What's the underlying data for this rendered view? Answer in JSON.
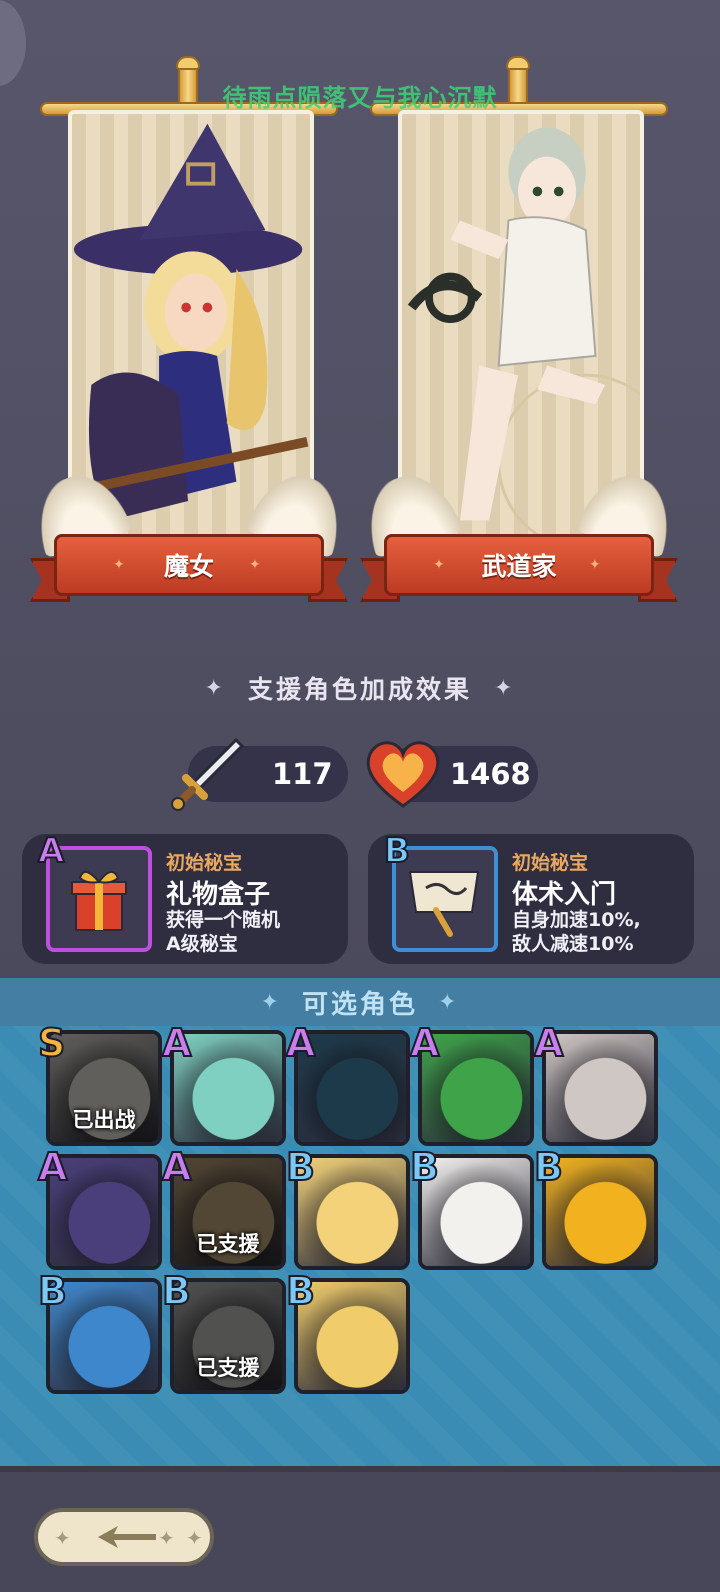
{
  "overlay_text": "待雨点陨落又与我心沉默",
  "banners": [
    {
      "name": "魔女",
      "palette": {
        "bg": "#2c2a52",
        "accent": "#f0c84b",
        "robe": "#3b3a8a"
      }
    },
    {
      "name": "武道家",
      "palette": {
        "bg": "#f4f1ea",
        "accent": "#9aa99a",
        "robe": "#ffffff"
      }
    }
  ],
  "support": {
    "title": "支援角色加成效果",
    "attack": "117",
    "hp": "1468"
  },
  "treasures": [
    {
      "grade": "A",
      "kind": "初始秘宝",
      "name": "礼物盒子",
      "desc_line1": "获得一个随机",
      "desc_line2": "A级秘宝",
      "icon": "gift-box-icon"
    },
    {
      "grade": "B",
      "kind": "初始秘宝",
      "name": "体术入门",
      "desc_line1": "自身加速10%,",
      "desc_line2": "敌人减速10%",
      "icon": "scroll-icon"
    }
  ],
  "selectable": {
    "title": "可选角色",
    "roster": [
      {
        "grade": "S",
        "state": "已出战",
        "color": "#d8d3c8",
        "dim": true
      },
      {
        "grade": "A",
        "state": "",
        "color": "#7fd0c0",
        "dim": false
      },
      {
        "grade": "A",
        "state": "",
        "color": "#1d3a4a",
        "dim": false
      },
      {
        "grade": "A",
        "state": "",
        "color": "#3fa34a",
        "dim": false
      },
      {
        "grade": "A",
        "state": "",
        "color": "#cfc7c4",
        "dim": false
      },
      {
        "grade": "A",
        "state": "",
        "color": "#4a3f7a",
        "dim": false
      },
      {
        "grade": "A",
        "state": "已支援",
        "color": "#c79a58",
        "dim": true
      },
      {
        "grade": "B",
        "state": "",
        "color": "#f3d27a",
        "dim": false
      },
      {
        "grade": "B",
        "state": "",
        "color": "#f3f1ee",
        "dim": false
      },
      {
        "grade": "B",
        "state": "",
        "color": "#f2b21f",
        "dim": false
      },
      {
        "grade": "B",
        "state": "",
        "color": "#3f87cc",
        "dim": false
      },
      {
        "grade": "B",
        "state": "已支援",
        "color": "#b3b6ae",
        "dim": true
      },
      {
        "grade": "B",
        "state": "",
        "color": "#f0cc6a",
        "dim": false
      }
    ]
  }
}
